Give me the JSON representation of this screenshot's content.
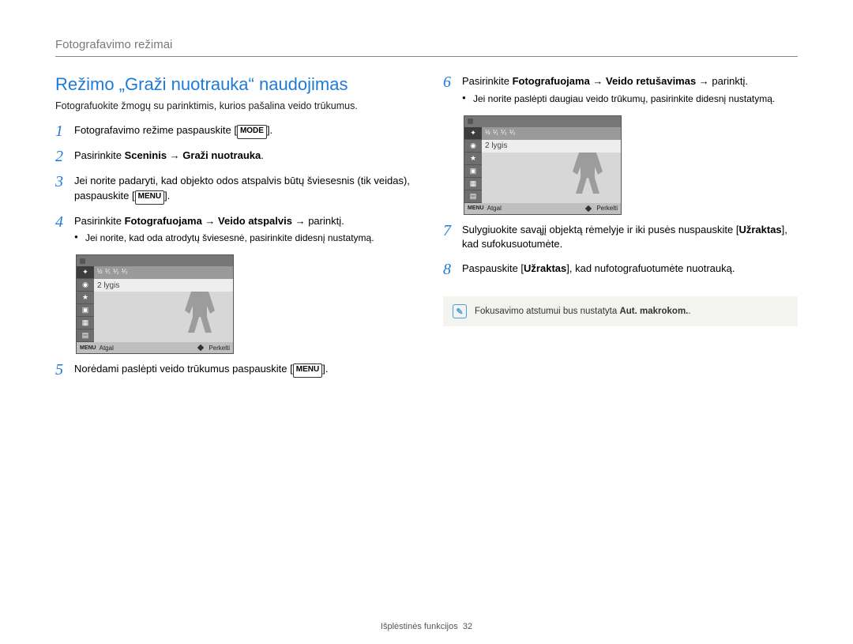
{
  "header": {
    "breadcrumb": "Fotografavimo režimai"
  },
  "title": "Režimo „Graži nuotrauka“ naudojimas",
  "intro": "Fotografuokite žmogų su parinktimis, kurios pašalina veido trūkumus.",
  "keys": {
    "mode": "MODE",
    "menu": "MENU"
  },
  "steps": {
    "s1": {
      "n": "1",
      "pre": "Fotografavimo režime paspauskite [",
      "post": "]."
    },
    "s2": {
      "n": "2",
      "pre": "Pasirinkite ",
      "bold": "Sceninis → Graži nuotrauka",
      "post": "."
    },
    "s3": {
      "n": "3",
      "line": "Jei norite padaryti, kad objekto odos atspalvis būtų šviesesnis (tik veidas), paspauskite [",
      "post": "]."
    },
    "s4": {
      "n": "4",
      "pre": "Pasirinkite ",
      "bold": "Fotografuojama → Veido atspalvis →",
      "tail": " parinktį.",
      "bullet": "Jei norite, kad oda atrodytų šviesesnė, pasirinkite didesnį nustatymą."
    },
    "s5": {
      "n": "5",
      "pre": "Norėdami paslėpti veido trūkumus paspauskite [",
      "post": "]."
    },
    "s6": {
      "n": "6",
      "pre": "Pasirinkite ",
      "bold": "Fotografuojama → Veido retušavimas →",
      "tail": " parinktį.",
      "bullet": "Jei norite paslėpti daugiau veido trūkumų, pasirinkite didesnį nustatymą."
    },
    "s7": {
      "n": "7",
      "line_a": "Sulygiuokite savąjį objektą rėmelyje ir iki pusės nuspauskite [",
      "bold": "Užraktas",
      "line_b": "], kad sufokusuotumėte."
    },
    "s8": {
      "n": "8",
      "line_a": "Paspauskite [",
      "bold": "Užraktas",
      "line_b": "], kad nufotografuotumėte nuotrauką."
    }
  },
  "camera": {
    "level": "2 lygis",
    "back": "Atgal",
    "move": "Perkelti",
    "menu": "MENU",
    "fractions": [
      "½",
      "⅟₁",
      "⅟₂",
      "⅟₃"
    ]
  },
  "note": {
    "text_a": "Fokusavimo atstumui bus nustatyta ",
    "bold": "Aut. makrokom.",
    "text_b": "."
  },
  "footer": {
    "text": "Išplėstinės funkcijos",
    "page": "32"
  }
}
